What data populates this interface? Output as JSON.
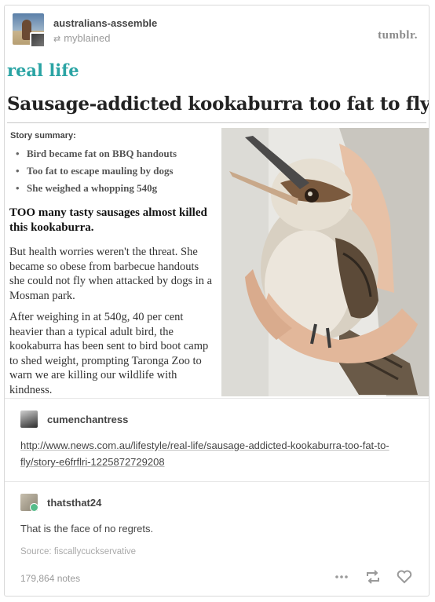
{
  "post": {
    "blog_name": "australians-assemble",
    "reblogged_from": "myblained",
    "logo": "tumblr."
  },
  "article": {
    "section": "real life",
    "headline": "Sausage-addicted kookaburra too fat to fly",
    "summary_label": "Story summary:",
    "bullets": [
      "Bird became fat on BBQ handouts",
      "Too fat to escape mauling by dogs",
      "She weighed a whopping 540g"
    ],
    "lead": "TOO many tasty sausages almost killed this kookaburra.",
    "paragraphs": [
      "But health worries weren't the threat. She became so obese from barbecue handouts she could not fly when attacked by dogs in a Mosman park.",
      "After weighing in at 540g, 40 per cent heavier than a typical adult bird, the kookaburra has been sent to bird boot camp to shed weight, prompting Taronga Zoo to warn we are killing our wildlife with kindness."
    ]
  },
  "reblogs": [
    {
      "username": "cumenchantress",
      "link": "http://www.news.com.au/lifestyle/real-life/sausage-addicted-kookaburra-too-fat-to-fly/story-e6frflri-1225872729208"
    },
    {
      "username": "thatsthat24",
      "text": "That is the face of no regrets."
    }
  ],
  "footer": {
    "source": "Source: fiscallycuckservative",
    "notes": "179,864 notes"
  },
  "icons": {
    "reblog": "reblog-icon",
    "more": "more-icon",
    "like": "heart-icon"
  },
  "colors": {
    "section_teal": "#2aa4a4",
    "text": "#444444",
    "muted": "#9a9a9a"
  }
}
